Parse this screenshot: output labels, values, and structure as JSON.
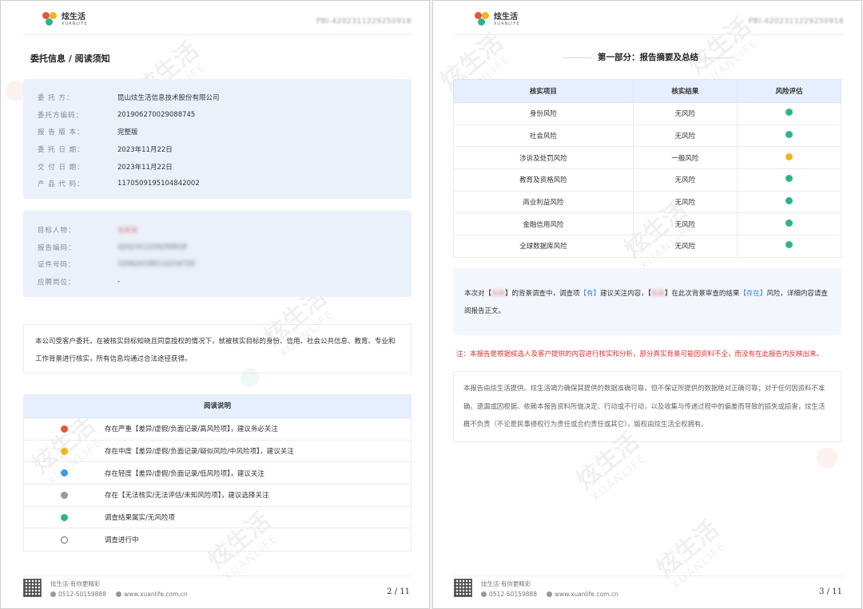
{
  "brand": {
    "name": "炫生活",
    "sub": "XUANLIFE",
    "report_code": "PBI-4202311229250918",
    "watermark": "炫生活",
    "watermark_sub": "XUANLIFE",
    "colors": {
      "red": "#e8543f",
      "yellow": "#f2b51e",
      "blue": "#3f9ae0",
      "gray": "#9a9a9a",
      "green": "#2eb48c"
    }
  },
  "left": {
    "section_title": "委托信息 / 阅读须知",
    "entrust": [
      {
        "label": "委 托 方：",
        "value": "昆山炫生活信息技术股份有限公司"
      },
      {
        "label": "委托方编码：",
        "value": "201906270029088745"
      },
      {
        "label": "报 告 版 本：",
        "value": "完整版"
      },
      {
        "label": "委 托 日 期：",
        "value": "2023年11月22日"
      },
      {
        "label": "交 付 日 期：",
        "value": "2023年11月22日"
      },
      {
        "label": "产 品 代 码：",
        "value": "1170509195104842002"
      }
    ],
    "target": [
      {
        "label": "目标人物：",
        "value": "张某某"
      },
      {
        "label": "报告编码：",
        "value": "4202311229250918"
      },
      {
        "label": "证件号码：",
        "value": "320624199112234720"
      },
      {
        "label": "应聘岗位：",
        "value": "-"
      }
    ],
    "notice": "本公司受客户委托，在被核实目标知晓且同意授权的情况下，就被核实目标的身份、信用、社会公共信息、教育、专业和工作背景进行核实，所有信息均通过合法途径获得。",
    "legend_title": "阅读说明",
    "legend": [
      {
        "color": "red",
        "text": "存在严重【差异/虚假/负面记录/高风险项】，建议务必关注"
      },
      {
        "color": "yellow",
        "text": "存在中度【差异/虚假/负面记录/疑似风险/中风险项】，建议关注"
      },
      {
        "color": "blue",
        "text": "存在轻度【差异/虚假/负面记录/低风险项】，建议关注"
      },
      {
        "color": "gray",
        "text": "存在【无法核实/无法评估/未知风险项】，建议选择关注"
      },
      {
        "color": "green",
        "text": "调查结果属实/无风险项"
      },
      {
        "color": "hollow",
        "text": "调查进行中"
      }
    ],
    "page_num": "2 / 11"
  },
  "right": {
    "part_title": "第一部分：报告摘要及总结",
    "table_headers": [
      "核实项目",
      "核实结果",
      "风险评估"
    ],
    "rows": [
      {
        "item": "身份风险",
        "result": "无风险",
        "risk": "green"
      },
      {
        "item": "社会风险",
        "result": "无风险",
        "risk": "green"
      },
      {
        "item": "涉诉及处罚风险",
        "result": "一般风险",
        "risk": "yellow"
      },
      {
        "item": "教育及资格风险",
        "result": "无风险",
        "risk": "green"
      },
      {
        "item": "商业利益风险",
        "result": "无风险",
        "risk": "green"
      },
      {
        "item": "金融信用风险",
        "result": "无风险",
        "risk": "green"
      },
      {
        "item": "全球数据库风险",
        "result": "无风险",
        "risk": "green"
      }
    ],
    "summary": {
      "p1": "本次对【",
      "name1": "张某",
      "p2": "】的背景调查中，调查项",
      "h1": "【有】",
      "p3": "建议关注内容，【",
      "name2": "张某",
      "p4": "】在此次背景审查的结果",
      "h2": "【存在】",
      "p5": "风险，详细内容请查阅报告正文。"
    },
    "note": "注：本报告是根据候选人及客户提供的内容进行核实和分析，部分真实背景可能因资料不全，而没有在此报告内反映出来。",
    "disclaimer": "本报告由炫生活提供。炫生活竭力确保其提供的数据准确可靠，但不保证所提供的数据绝对正确可靠；对于任何因资料不准确、遗漏或因根据、依赖本报告资料所做决定、行动或不行动，以及收集与传递过程中的偏差而导致的损失或损害，炫生活概不负责（不论是民事侵权行为责任或合约责任或其它）。版权由炫生活全权拥有。",
    "page_num": "3 / 11"
  },
  "footer": {
    "slogan": "炫生活·有你更精彩",
    "phone": "0512-50159888",
    "website": "www.xuanlife.com.cn"
  }
}
